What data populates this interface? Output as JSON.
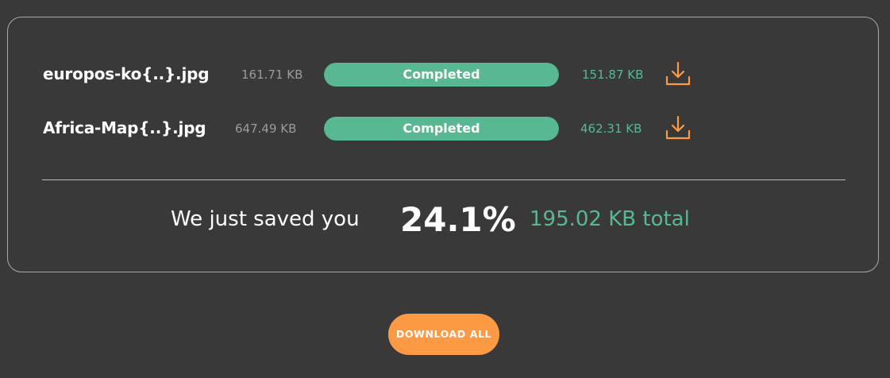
{
  "files": [
    {
      "name": "europos-ko{..}.jpg",
      "original_size": "161.71 KB",
      "status": "Completed",
      "progress": 1.0,
      "compressed_size": "151.87 KB",
      "download_icon": "download-icon"
    },
    {
      "name": "Africa-Map{..}.jpg",
      "original_size": "647.49 KB",
      "status": "Completed",
      "progress": 1.0,
      "compressed_size": "462.31 KB",
      "download_icon": "download-icon"
    }
  ],
  "summary": {
    "prefix": "We just saved you",
    "percent": "24.1%",
    "total": "195.02 KB total"
  },
  "actions": {
    "download_all_label": "DOWNLOAD ALL"
  },
  "colors": {
    "background": "#393939",
    "accent_green": "#58b891",
    "accent_orange": "#ff9a44",
    "muted_text": "#9b9b9b"
  }
}
